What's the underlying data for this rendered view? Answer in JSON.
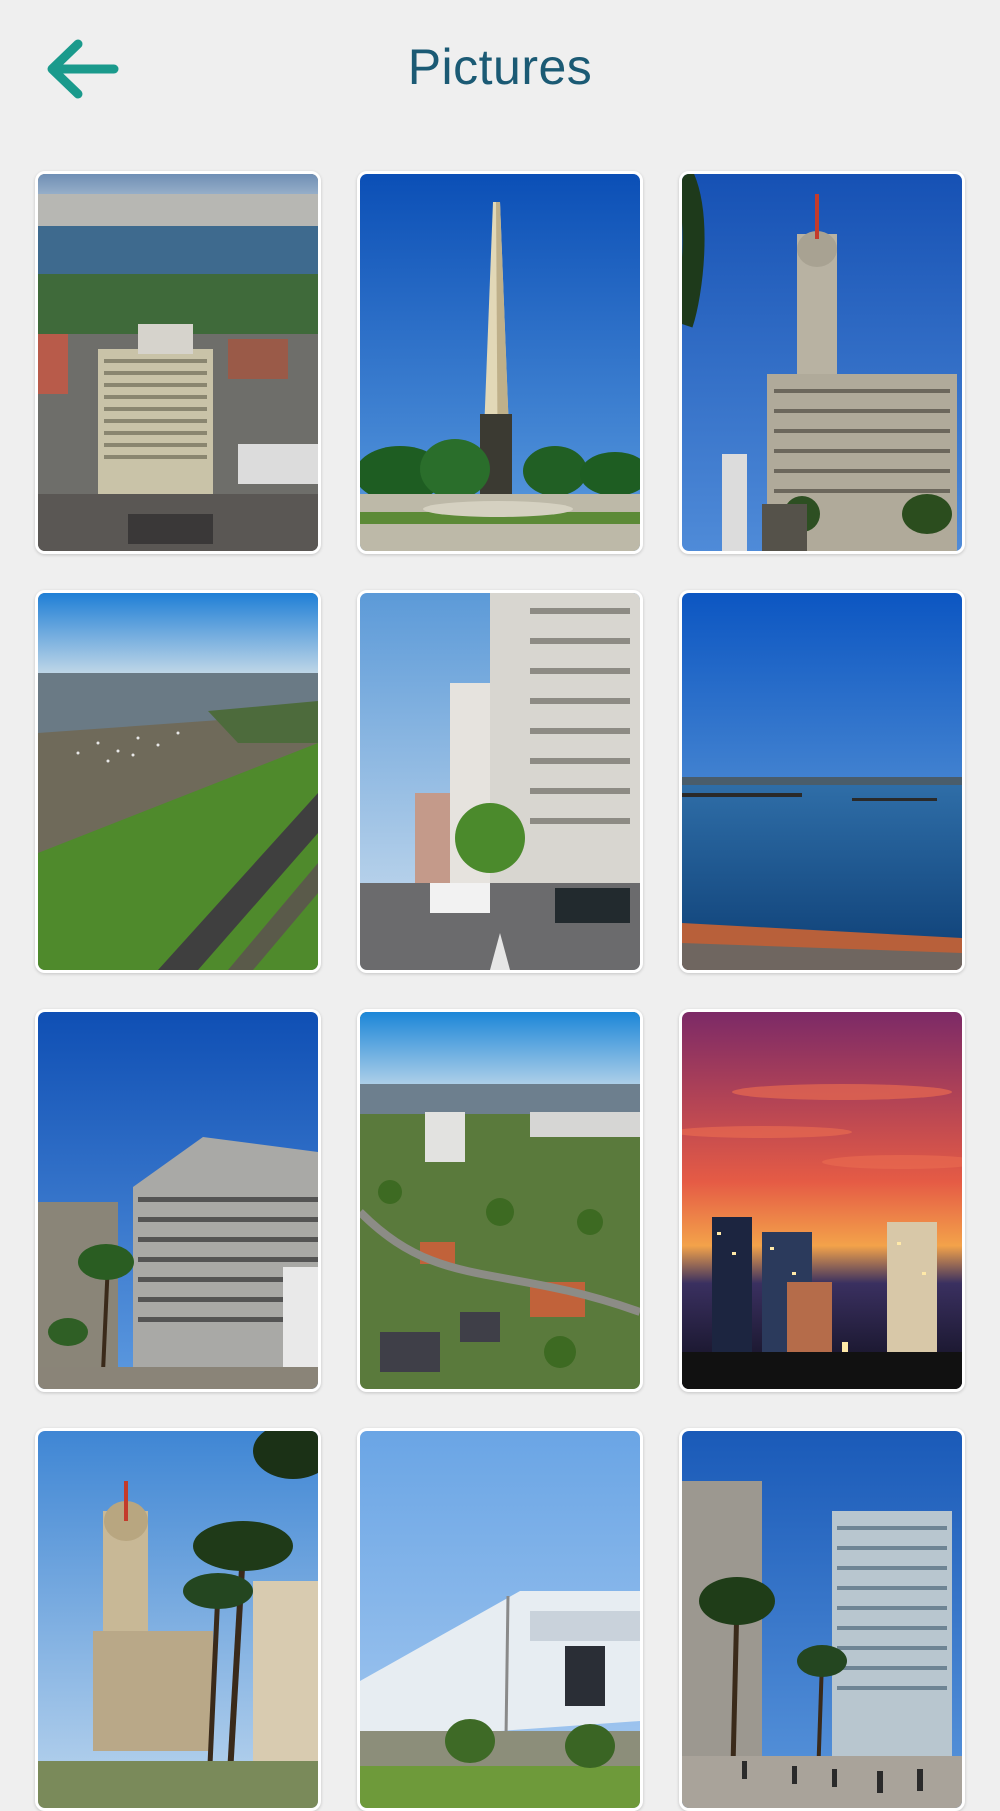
{
  "header": {
    "title": "Pictures",
    "back_icon": "arrow-left-icon",
    "accent_color": "#1a9a8c"
  },
  "gallery": {
    "items": [
      {
        "subject": "aerial-city-bay-photo"
      },
      {
        "subject": "obelisk-monument-photo"
      },
      {
        "subject": "palacio-salvo-tower-photo"
      },
      {
        "subject": "coastal-aerial-harbor-photo"
      },
      {
        "subject": "city-street-high-rises-photo"
      },
      {
        "subject": "waterfront-bay-photo"
      },
      {
        "subject": "plaza-buildings-photo"
      },
      {
        "subject": "aerial-neighborhood-photo"
      },
      {
        "subject": "city-sunset-night-photo"
      },
      {
        "subject": "palacio-salvo-palms-photo"
      },
      {
        "subject": "white-building-sky-photo"
      },
      {
        "subject": "plaza-towers-crowd-photo"
      }
    ]
  }
}
